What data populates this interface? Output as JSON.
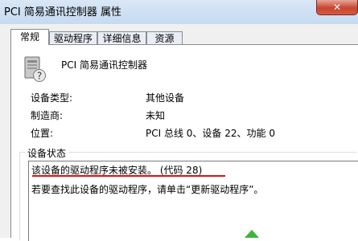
{
  "window": {
    "title": "PCI 简易通讯控制器 属性",
    "close_symbol": "✕"
  },
  "tabs": [
    {
      "label": "常规",
      "active": true
    },
    {
      "label": "驱动程序",
      "active": false
    },
    {
      "label": "详细信息",
      "active": false
    },
    {
      "label": "资源",
      "active": false
    }
  ],
  "device": {
    "name": "PCI 简易通讯控制器",
    "icon": "unknown-device-icon",
    "properties": [
      {
        "label": "设备类型:",
        "value": "其他设备"
      },
      {
        "label": "制造商:",
        "value": "未知"
      },
      {
        "label": "位置:",
        "value": "PCI 总线 0、设备 22、功能 0"
      }
    ]
  },
  "status": {
    "group_label": "设备状态",
    "line1": "该设备的驱动程序未被安装。 (代码 28)",
    "line2": "若要查找此设备的驱动程序，请单击“更新驱动程序”。"
  },
  "colors": {
    "underline": "#d41515",
    "close_button": "#c8452f",
    "arrow": "#3fb43a"
  }
}
